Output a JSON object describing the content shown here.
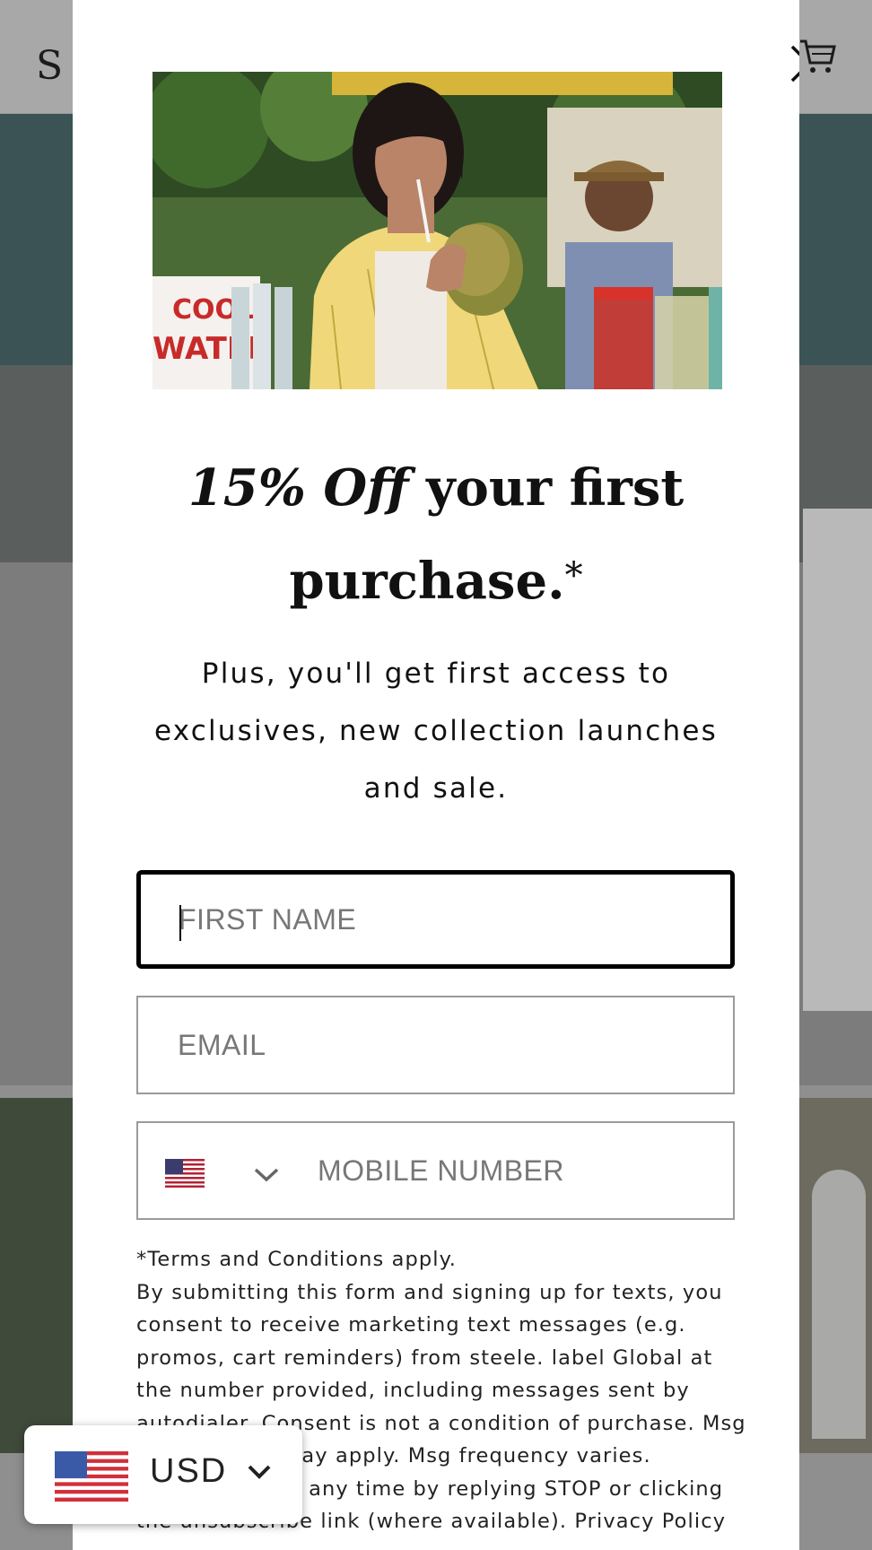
{
  "background": {
    "logo_text": "S"
  },
  "popup": {
    "headline_emphasis": "15% Off",
    "headline_rest": " your first purchase.",
    "headline_asterisk": "*",
    "subtext": "Plus, you'll get first access to exclusives, new collection launches and sale.",
    "first_name_placeholder": "FIRST NAME",
    "email_placeholder": "EMAIL",
    "phone_placeholder": "MOBILE NUMBER",
    "phone_country": "US",
    "terms_heading": "*Terms and Conditions apply.",
    "terms_body": "By submitting this form and signing up for texts, you consent to receive marketing text messages (e.g. promos, cart reminders) from steele. label Global at the number provided, including messages sent by autodialer. Consent is not a condition of purchase. Msg & data rates may apply. Msg frequency varies. Unsubscribe at any time by replying STOP or clicking the unsubscribe link (where available).",
    "privacy_link": "Privacy Policy",
    "photo_sign_line1": "COOL",
    "photo_sign_line2": "WATER"
  },
  "currency_switcher": {
    "code": "USD"
  },
  "icons": {
    "close": "close-icon",
    "cart": "cart-icon",
    "flag": "us-flag-icon",
    "chevron": "chevron-down-icon"
  },
  "colors": {
    "overlay": "#8f8f8f",
    "modal_bg": "#ffffff",
    "text": "#111111",
    "field_border": "#9a9a9a",
    "focus_border": "#000000"
  }
}
